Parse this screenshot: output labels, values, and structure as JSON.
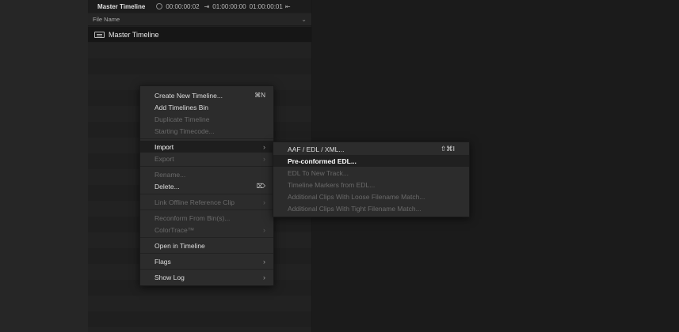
{
  "panel": {
    "title": "Master Timeline",
    "timecode_current": "00:00:00:02",
    "timecode_in": "01:00:00:00",
    "timecode_out": "01:00:00:01",
    "column_header": "File Name",
    "master_row_label": "Master Timeline"
  },
  "context_menu": {
    "items": [
      {
        "label": "Create New Timeline...",
        "shortcut": "⌘N",
        "enabled": true,
        "submenu": false
      },
      {
        "label": "Add Timelines Bin",
        "shortcut": "",
        "enabled": true,
        "submenu": false
      },
      {
        "label": "Duplicate Timeline",
        "shortcut": "",
        "enabled": false,
        "submenu": false
      },
      {
        "label": "Starting Timecode...",
        "shortcut": "",
        "enabled": false,
        "submenu": false
      },
      {
        "label": "Import",
        "shortcut": "",
        "enabled": true,
        "submenu": true,
        "highlighted": true
      },
      {
        "label": "Export",
        "shortcut": "",
        "enabled": false,
        "submenu": true
      },
      {
        "label": "Rename...",
        "shortcut": "",
        "enabled": false,
        "submenu": false
      },
      {
        "label": "Delete...",
        "shortcut": "⌦",
        "enabled": true,
        "submenu": false
      },
      {
        "label": "Link Offline Reference Clip",
        "shortcut": "",
        "enabled": false,
        "submenu": true
      },
      {
        "label": "Reconform From Bin(s)...",
        "shortcut": "",
        "enabled": false,
        "submenu": false
      },
      {
        "label": "ColorTrace™",
        "shortcut": "",
        "enabled": false,
        "submenu": true
      },
      {
        "label": "Open in Timeline",
        "shortcut": "",
        "enabled": true,
        "submenu": false
      },
      {
        "label": "Flags",
        "shortcut": "",
        "enabled": true,
        "submenu": true
      },
      {
        "label": "Show Log",
        "shortcut": "",
        "enabled": true,
        "submenu": true
      }
    ]
  },
  "import_submenu": {
    "items": [
      {
        "label": "AAF / EDL / XML...",
        "shortcut": "⇧⌘I",
        "enabled": true
      },
      {
        "label": "Pre-conformed EDL...",
        "shortcut": "",
        "enabled": true,
        "highlighted": true
      },
      {
        "label": "EDL To New Track...",
        "shortcut": "",
        "enabled": false
      },
      {
        "label": "Timeline Markers from EDL...",
        "shortcut": "",
        "enabled": false
      },
      {
        "label": "Additional Clips With Loose Filename Match...",
        "shortcut": "",
        "enabled": false
      },
      {
        "label": "Additional Clips With Tight Filename Match...",
        "shortcut": "",
        "enabled": false
      }
    ]
  },
  "icons": {
    "timeline": "timeline-icon",
    "clock": "clock-icon",
    "submenu_arrow": "chevron-right-icon"
  }
}
